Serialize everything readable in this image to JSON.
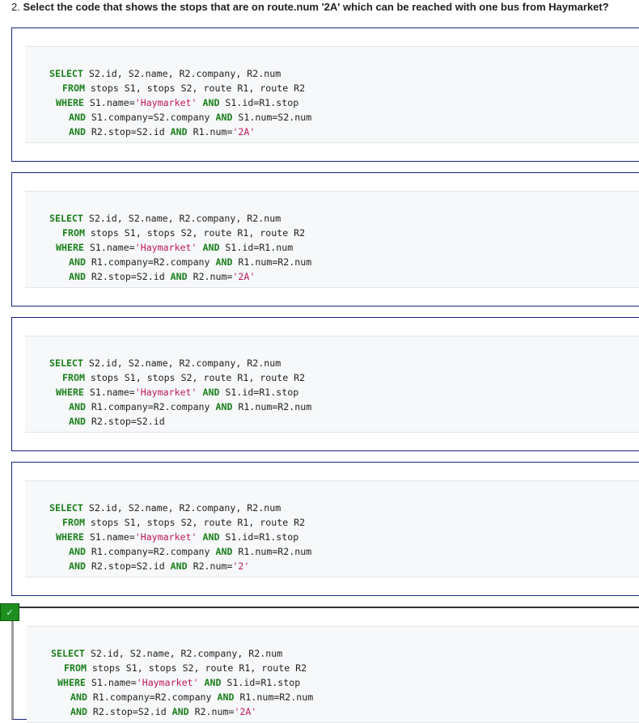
{
  "question": {
    "prefix": "2.",
    "words": [
      "Select the code that shows the stops that are on route.num '2A' which can be reached with one bus from Haymarket?"
    ]
  },
  "options": [
    {
      "lines": [
        [
          [
            "kw",
            "SELECT"
          ],
          [
            "t",
            " S2.id, S2.name, R2.company, R2.num"
          ]
        ],
        [
          [
            "kw",
            "FROM"
          ],
          [
            "t",
            " stops S1, stops S2, route R1, route R2"
          ]
        ],
        [
          [
            "kw",
            "WHERE"
          ],
          [
            "t",
            " S1.name="
          ],
          [
            "str",
            "'Haymarket'"
          ],
          [
            "t",
            " "
          ],
          [
            "kw",
            "AND"
          ],
          [
            "t",
            " S1.id=R1.stop"
          ]
        ],
        [
          [
            "kw",
            "AND"
          ],
          [
            "t",
            " S1.company=S2.company "
          ],
          [
            "kw",
            "AND"
          ],
          [
            "t",
            " S1.num=S2.num"
          ]
        ],
        [
          [
            "kw",
            "AND"
          ],
          [
            "t",
            " R2.stop=S2.id "
          ],
          [
            "kw",
            "AND"
          ],
          [
            "t",
            " R1.num="
          ],
          [
            "str",
            "'2A'"
          ]
        ]
      ]
    },
    {
      "lines": [
        [
          [
            "kw",
            "SELECT"
          ],
          [
            "t",
            " S2.id, S2.name, R2.company, R2.num"
          ]
        ],
        [
          [
            "kw",
            "FROM"
          ],
          [
            "t",
            " stops S1, stops S2, route R1, route R2"
          ]
        ],
        [
          [
            "kw",
            "WHERE"
          ],
          [
            "t",
            " S1.name="
          ],
          [
            "str",
            "'Haymarket'"
          ],
          [
            "t",
            " "
          ],
          [
            "kw",
            "AND"
          ],
          [
            "t",
            " S1.id=R1.num"
          ]
        ],
        [
          [
            "kw",
            "AND"
          ],
          [
            "t",
            " R1.company=R2.company "
          ],
          [
            "kw",
            "AND"
          ],
          [
            "t",
            " R1.num=R2.num"
          ]
        ],
        [
          [
            "kw",
            "AND"
          ],
          [
            "t",
            " R2.stop=S2.id "
          ],
          [
            "kw",
            "AND"
          ],
          [
            "t",
            " R2.num="
          ],
          [
            "str",
            "'2A'"
          ]
        ]
      ]
    },
    {
      "lines": [
        [
          [
            "kw",
            "SELECT"
          ],
          [
            "t",
            " S2.id, S2.name, R2.company, R2.num"
          ]
        ],
        [
          [
            "kw",
            "FROM"
          ],
          [
            "t",
            " stops S1, stops S2, route R1, route R2"
          ]
        ],
        [
          [
            "kw",
            "WHERE"
          ],
          [
            "t",
            " S1.name="
          ],
          [
            "str",
            "'Haymarket'"
          ],
          [
            "t",
            " "
          ],
          [
            "kw",
            "AND"
          ],
          [
            "t",
            " S1.id=R1.stop"
          ]
        ],
        [
          [
            "kw",
            "AND"
          ],
          [
            "t",
            " R1.company=R2.company "
          ],
          [
            "kw",
            "AND"
          ],
          [
            "t",
            " R1.num=R2.num"
          ]
        ],
        [
          [
            "kw",
            "AND"
          ],
          [
            "t",
            " R2.stop=S2.id"
          ]
        ]
      ]
    },
    {
      "lines": [
        [
          [
            "kw",
            "SELECT"
          ],
          [
            "t",
            " S2.id, S2.name, R2.company, R2.num"
          ]
        ],
        [
          [
            "kw",
            "FROM"
          ],
          [
            "t",
            " stops S1, stops S2, route R1, route R2"
          ]
        ],
        [
          [
            "kw",
            "WHERE"
          ],
          [
            "t",
            " S1.name="
          ],
          [
            "str",
            "'Haymarket'"
          ],
          [
            "t",
            " "
          ],
          [
            "kw",
            "AND"
          ],
          [
            "t",
            " S1.id=R1.stop"
          ]
        ],
        [
          [
            "kw",
            "AND"
          ],
          [
            "t",
            " R1.company=R2.company "
          ],
          [
            "kw",
            "AND"
          ],
          [
            "t",
            " R1.num=R2.num"
          ]
        ],
        [
          [
            "kw",
            "AND"
          ],
          [
            "t",
            " R2.stop=S2.id "
          ],
          [
            "kw",
            "AND"
          ],
          [
            "t",
            " R2.num="
          ],
          [
            "str",
            "'2'"
          ]
        ]
      ]
    },
    {
      "selected": true,
      "lines": [
        [
          [
            "kw",
            "SELECT"
          ],
          [
            "t",
            " S2.id, S2.name, R2.company, R2.num"
          ]
        ],
        [
          [
            "kw",
            "FROM"
          ],
          [
            "t",
            " stops S1, stops S2, route R1, route R2"
          ]
        ],
        [
          [
            "kw",
            "WHERE"
          ],
          [
            "t",
            " S1.name="
          ],
          [
            "str",
            "'Haymarket'"
          ],
          [
            "t",
            " "
          ],
          [
            "kw",
            "AND"
          ],
          [
            "t",
            " S1.id=R1.stop"
          ]
        ],
        [
          [
            "kw",
            "AND"
          ],
          [
            "t",
            " R1.company=R2.company "
          ],
          [
            "kw",
            "AND"
          ],
          [
            "t",
            " R1.num=R2.num"
          ]
        ],
        [
          [
            "kw",
            "AND"
          ],
          [
            "t",
            " R2.stop=S2.id "
          ],
          [
            "kw",
            "AND"
          ],
          [
            "t",
            " R2.num="
          ],
          [
            "str",
            "'2A'"
          ]
        ]
      ]
    }
  ],
  "check_icon": "checkmark-icon",
  "check_glyph": "✓"
}
